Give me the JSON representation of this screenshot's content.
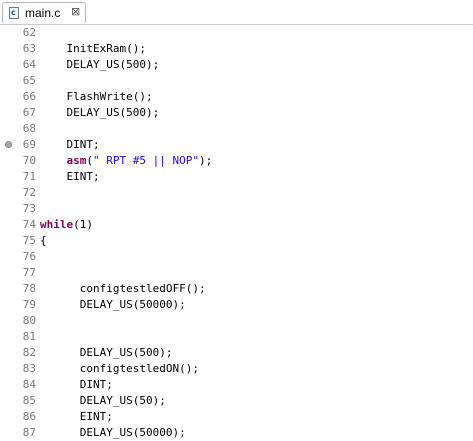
{
  "tab": {
    "label": "main.c",
    "close": "⊠",
    "icon_letter": "c"
  },
  "lines": [
    {
      "n": "62",
      "parts": []
    },
    {
      "n": "63",
      "parts": [
        {
          "t": "    InitExRam();"
        }
      ]
    },
    {
      "n": "64",
      "parts": [
        {
          "t": "    DELAY_US(500);"
        }
      ]
    },
    {
      "n": "65",
      "parts": []
    },
    {
      "n": "66",
      "parts": [
        {
          "t": "    FlashWrite();"
        }
      ]
    },
    {
      "n": "67",
      "parts": [
        {
          "t": "    DELAY_US(500);"
        }
      ]
    },
    {
      "n": "68",
      "parts": []
    },
    {
      "n": "69",
      "parts": [
        {
          "t": "    DINT;"
        }
      ],
      "marker": true
    },
    {
      "n": "70",
      "parts": [
        {
          "t": "    "
        },
        {
          "t": "asm",
          "c": "kw"
        },
        {
          "t": "("
        },
        {
          "t": "\" RPT #5 || NOP\"",
          "c": "str"
        },
        {
          "t": ");"
        }
      ]
    },
    {
      "n": "71",
      "parts": [
        {
          "t": "    EINT;"
        }
      ]
    },
    {
      "n": "72",
      "parts": []
    },
    {
      "n": "73",
      "parts": []
    },
    {
      "n": "74",
      "parts": [
        {
          "t": "while",
          "c": "kw"
        },
        {
          "t": "(1)"
        }
      ]
    },
    {
      "n": "75",
      "parts": [
        {
          "t": "{"
        }
      ]
    },
    {
      "n": "76",
      "parts": []
    },
    {
      "n": "77",
      "parts": []
    },
    {
      "n": "78",
      "parts": [
        {
          "t": "      configtestledOFF();"
        }
      ]
    },
    {
      "n": "79",
      "parts": [
        {
          "t": "      DELAY_US(50000);"
        }
      ]
    },
    {
      "n": "80",
      "parts": []
    },
    {
      "n": "81",
      "parts": []
    },
    {
      "n": "82",
      "parts": [
        {
          "t": "      DELAY_US(500);"
        }
      ]
    },
    {
      "n": "83",
      "parts": [
        {
          "t": "      configtestledON();"
        }
      ]
    },
    {
      "n": "84",
      "parts": [
        {
          "t": "      DINT;"
        }
      ]
    },
    {
      "n": "85",
      "parts": [
        {
          "t": "      DELAY_US(50);"
        }
      ]
    },
    {
      "n": "86",
      "parts": [
        {
          "t": "      EINT;"
        }
      ]
    },
    {
      "n": "87",
      "parts": [
        {
          "t": "      DELAY_US(50000);"
        }
      ]
    }
  ]
}
